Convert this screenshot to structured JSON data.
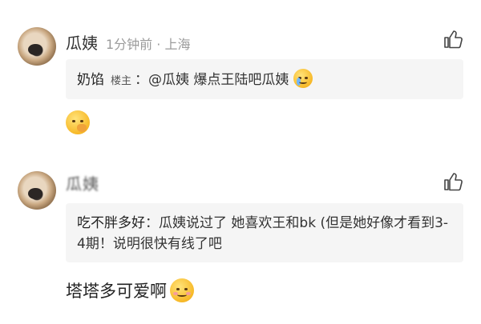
{
  "comments": [
    {
      "author": "瓜姨",
      "time_location": "1分钟前 · 上海",
      "like_icon": "thumbs-up-outline-icon",
      "quote": {
        "author": "奶馅",
        "tag": "楼主",
        "text": "：@瓜姨 爆点王陆吧瓜姨",
        "emoji": "crying-face-emoji"
      },
      "body_emoji": "hand-over-mouth-emoji"
    },
    {
      "author": "瓜姨",
      "like_icon": "thumbs-up-outline-icon",
      "quote": {
        "author": "吃不胖多好",
        "text": "：瓜姨说过了 她喜欢王和bk (但是她好像才看到3-4期！说明很快有线了吧"
      },
      "body_text": "塔塔多可爱啊",
      "body_emoji": "smiling-blush-emoji"
    }
  ],
  "colors": {
    "quote_bg": "#f5f5f5",
    "meta_gray": "#9b9b9b"
  }
}
